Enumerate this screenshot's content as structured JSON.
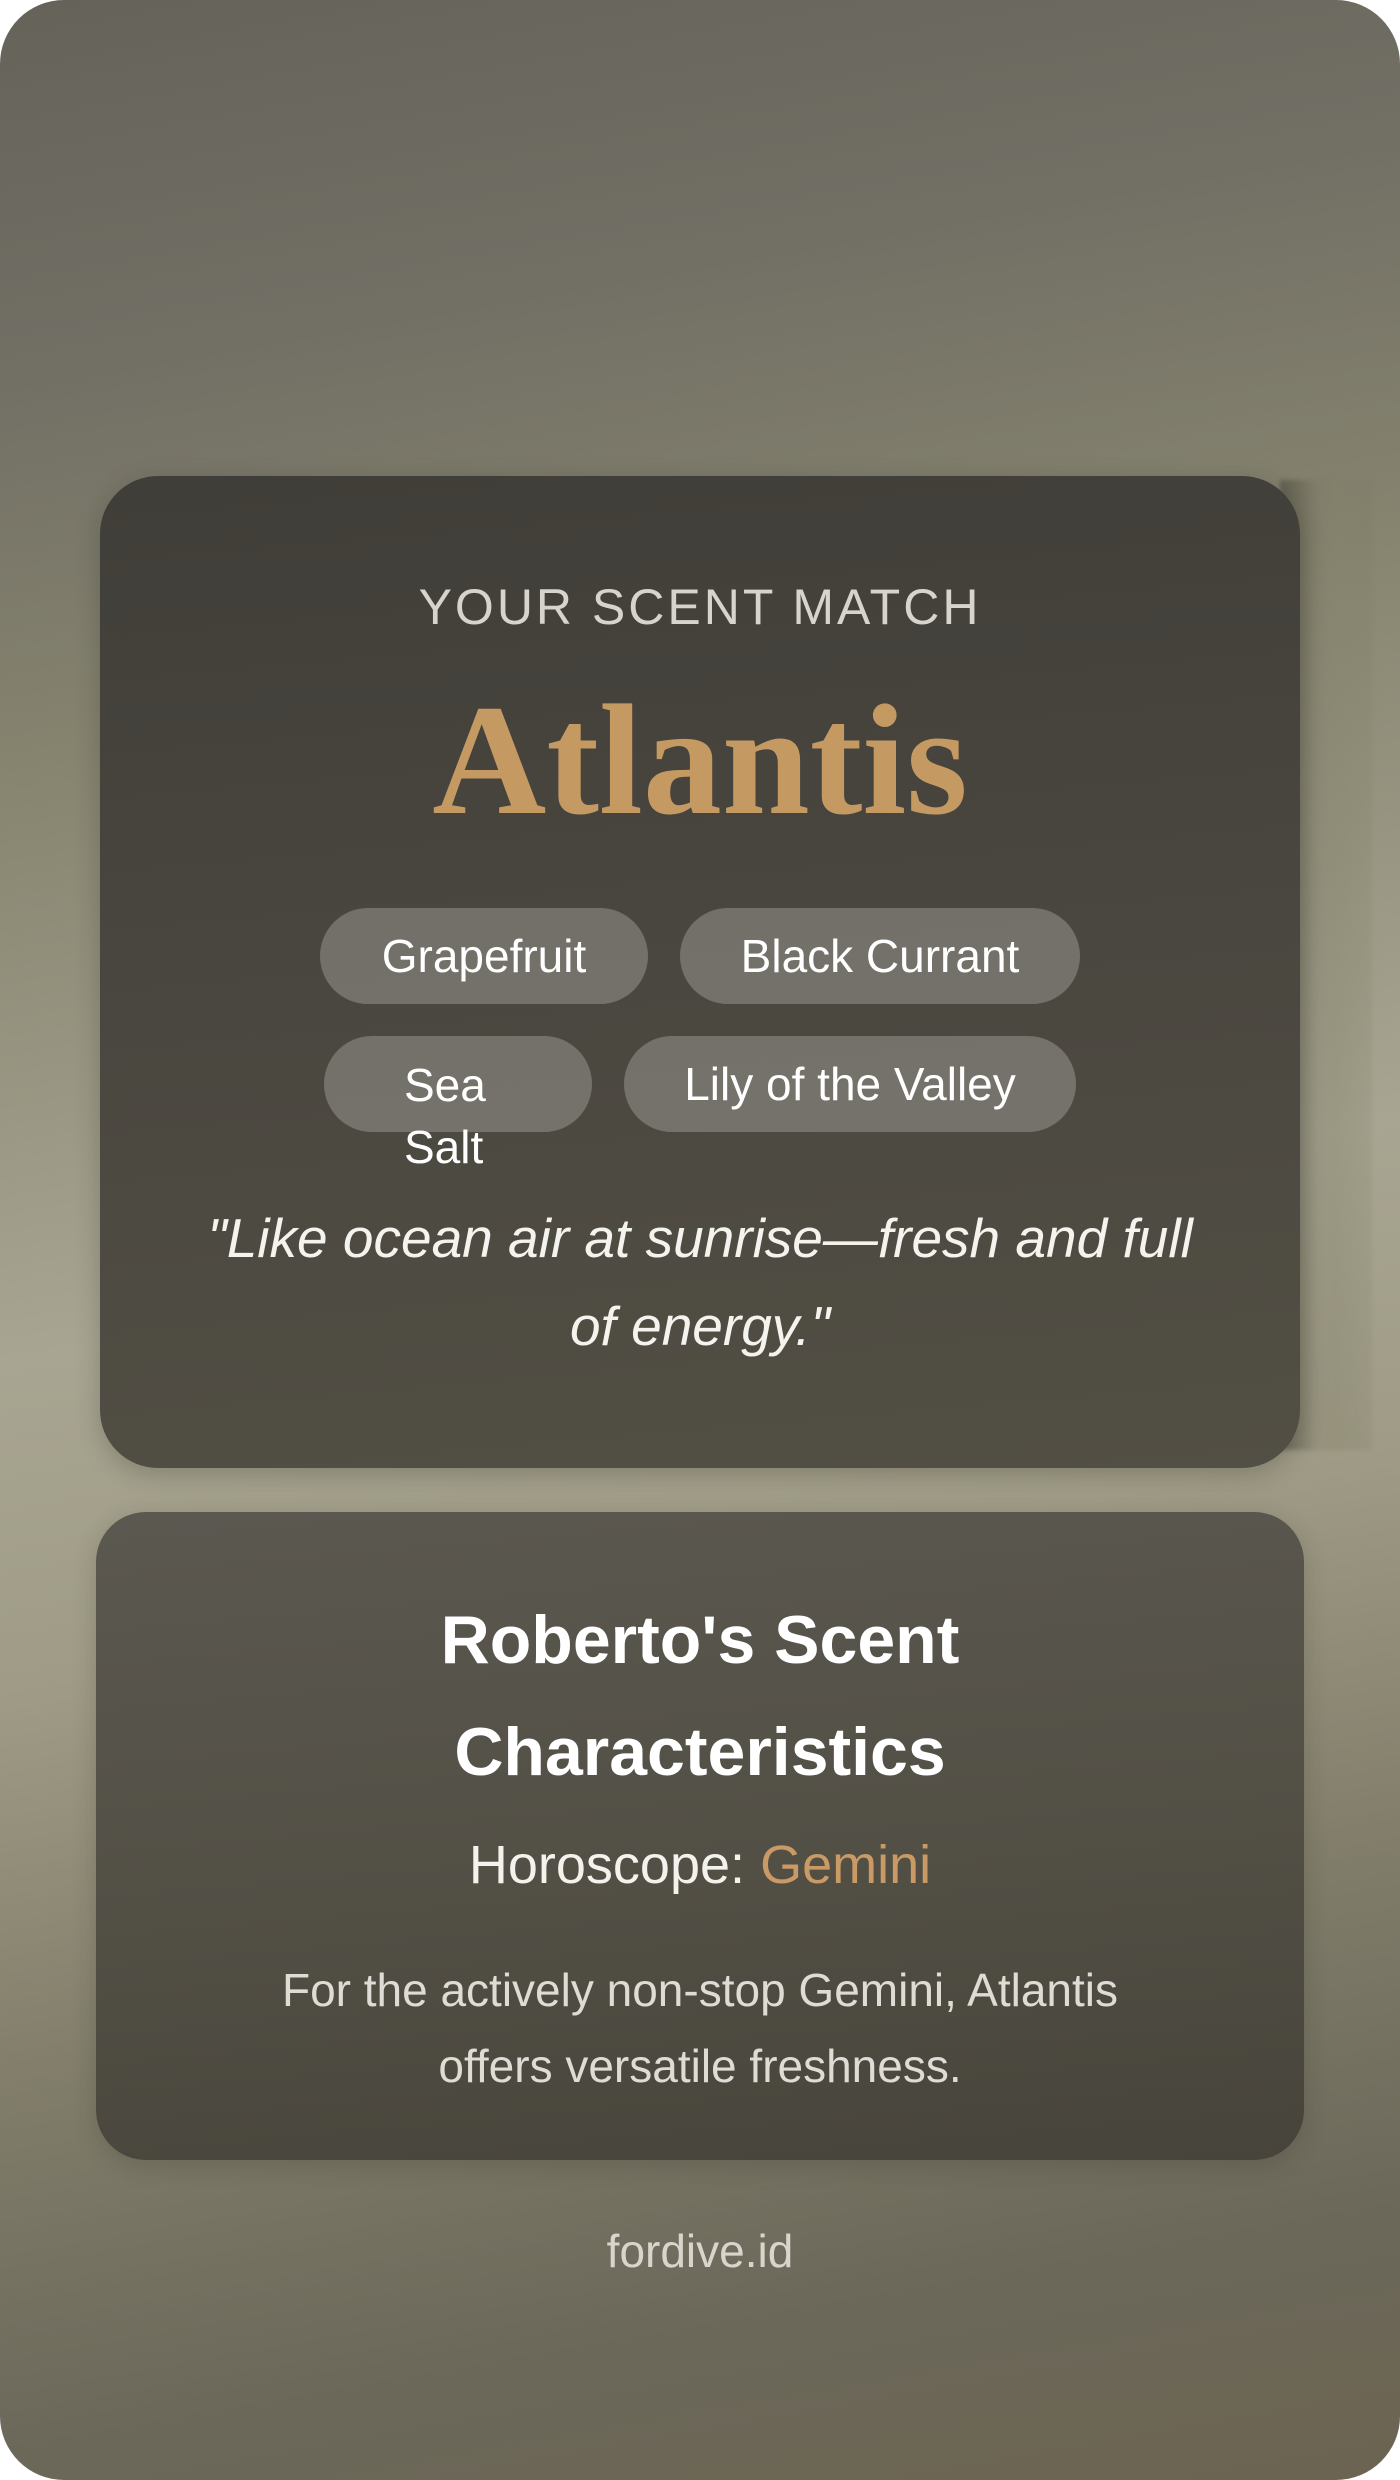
{
  "match": {
    "eyebrow": "YOUR SCENT MATCH",
    "scent_name": "Atlantis",
    "notes": [
      "Grapefruit",
      "Black Currant",
      "Sea Salt",
      "Lily of the Valley"
    ],
    "quote": "\"Like ocean air at sunrise—fresh and full of energy.\""
  },
  "characteristics": {
    "title": "Roberto's Scent Characteristics",
    "horoscope_label": "Horoscope:",
    "horoscope_sign": "Gemini",
    "description": "For the actively non-stop Gemini, Atlantis offers versatile freshness."
  },
  "footer": {
    "brand": "fordive.id"
  },
  "colors": {
    "accent": "#c59a62",
    "card_bg": "#4a4740",
    "pill_bg": "#7a7870"
  }
}
